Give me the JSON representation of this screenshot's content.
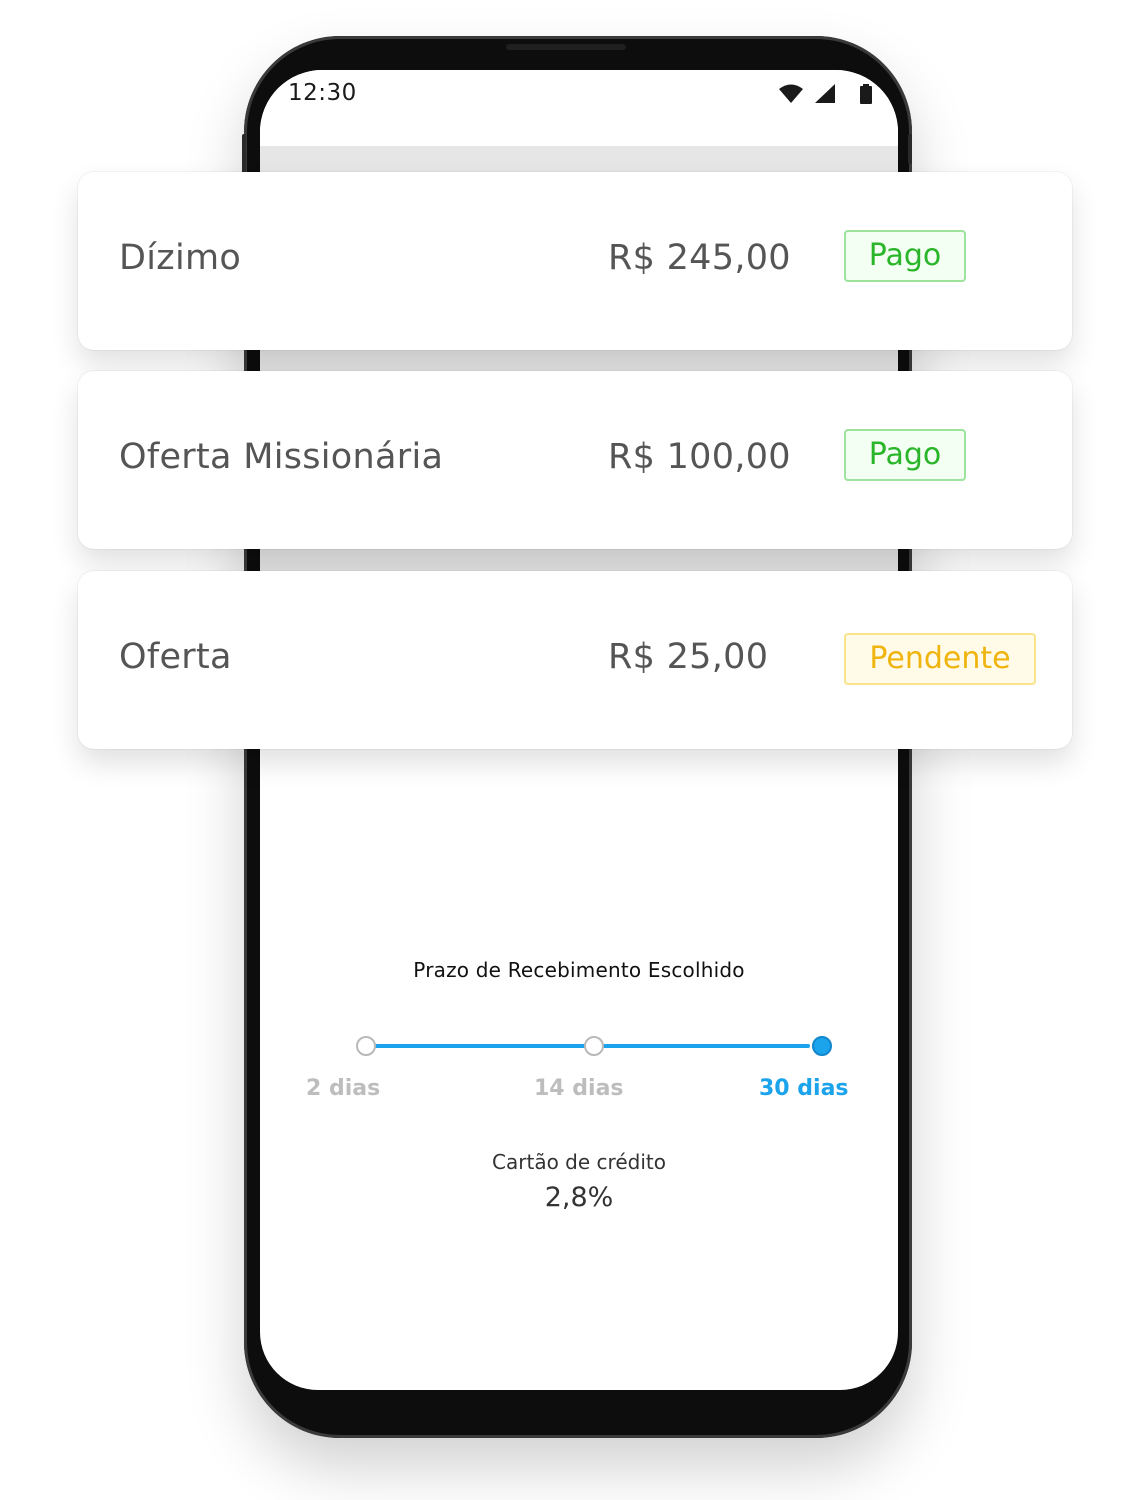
{
  "status_bar": {
    "time": "12:30",
    "icons": [
      "wifi-icon",
      "signal-icon",
      "battery-icon"
    ]
  },
  "transactions": [
    {
      "name": "Dízimo",
      "amount": "R$ 245,00",
      "status": "Pago"
    },
    {
      "name": "Oferta Missionária",
      "amount": "R$ 100,00",
      "status": "Pago"
    },
    {
      "name": "Oferta",
      "amount": "R$ 25,00",
      "status": "Pendente"
    }
  ],
  "receipt": {
    "title": "Prazo de Recebimento Escolhido",
    "options": [
      "2 dias",
      "14 dias",
      "30 dias"
    ],
    "selected": "30 dias",
    "method_label": "Cartão de crédito",
    "rate": "2,8%"
  },
  "colors": {
    "accent": "#1ba3ec",
    "paid": "#2ab52a",
    "pending": "#f0b40e"
  }
}
